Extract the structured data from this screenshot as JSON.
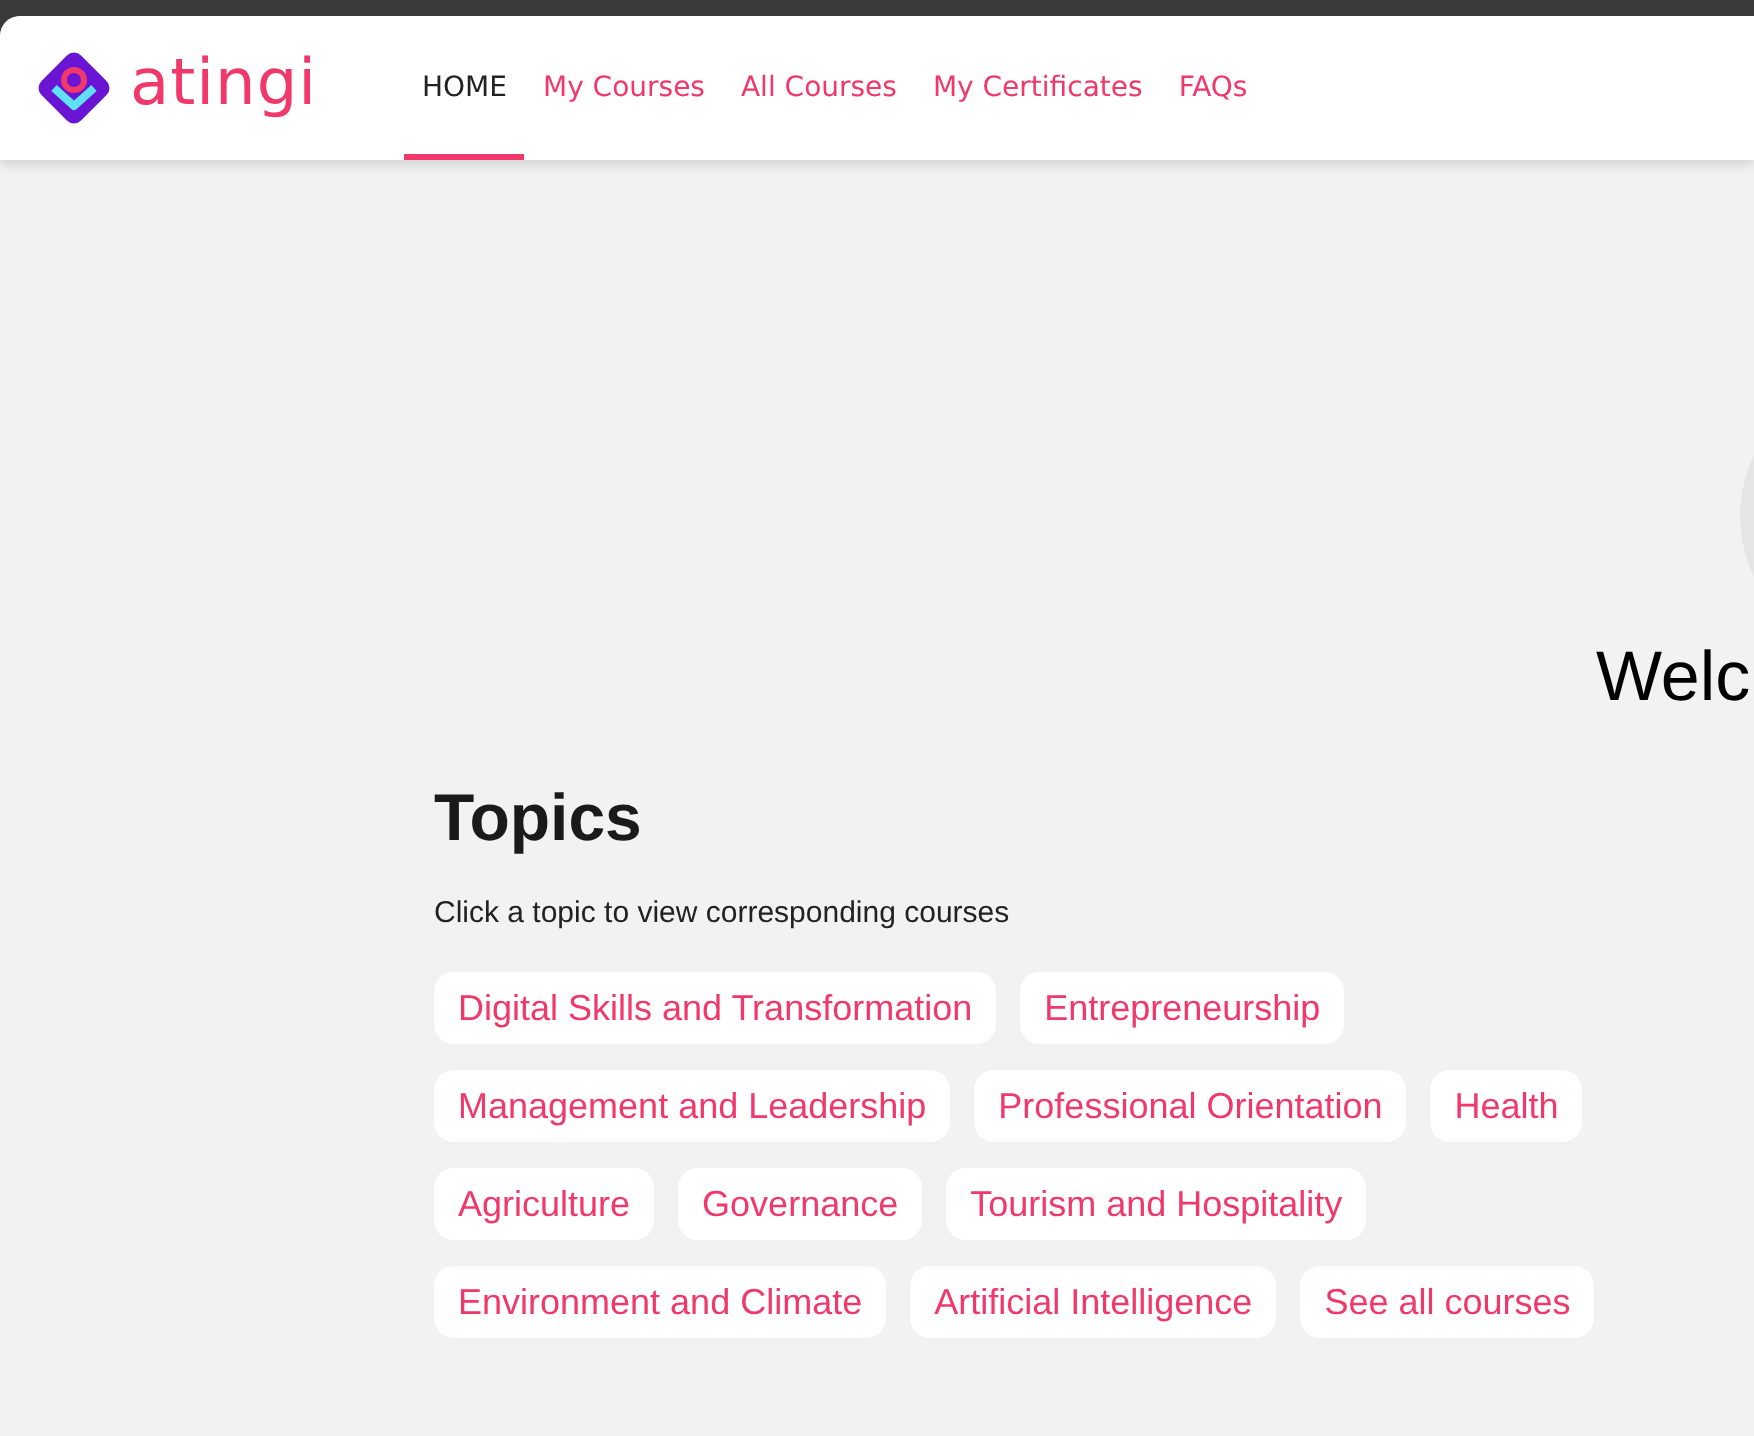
{
  "logo": {
    "text": "atingi"
  },
  "nav": [
    {
      "label": "HOME",
      "selected": true
    },
    {
      "label": "My Courses",
      "selected": false
    },
    {
      "label": "All Courses",
      "selected": false
    },
    {
      "label": "My Certificates",
      "selected": false
    },
    {
      "label": "FAQs",
      "selected": false
    }
  ],
  "hero": {
    "heading": "Welc"
  },
  "topics": {
    "title": "Topics",
    "subtitle": "Click a topic to view corresponding courses",
    "chips": [
      "Digital Skills and Transformation",
      "Entrepreneurship",
      "Management and Leadership",
      "Professional Orientation",
      "Health",
      "Agriculture",
      "Governance",
      "Tourism and Hospitality",
      "Environment and Climate",
      "Artificial Intelligence",
      "See all courses"
    ]
  }
}
